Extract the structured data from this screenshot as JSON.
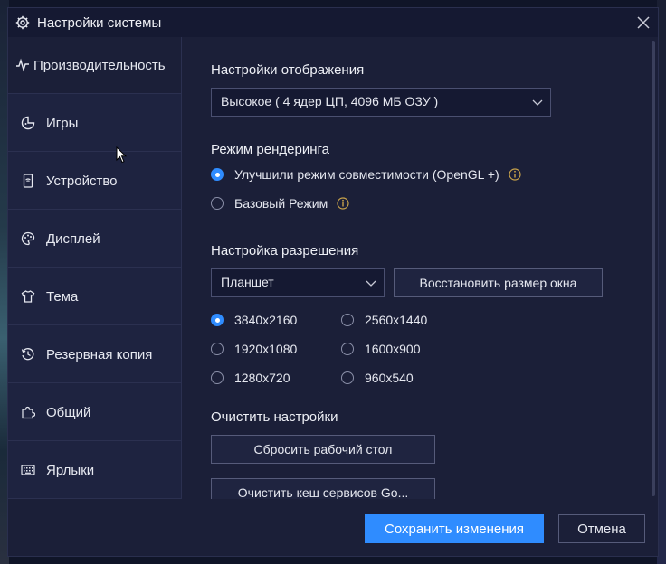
{
  "window": {
    "title": "Настройки системы"
  },
  "sidebar": {
    "items": [
      {
        "label": "Производительность",
        "icon": "pulse-icon",
        "active": true
      },
      {
        "label": "Игры",
        "icon": "gamepad-icon"
      },
      {
        "label": "Устройство",
        "icon": "phone-icon"
      },
      {
        "label": "Дисплей",
        "icon": "palette-icon"
      },
      {
        "label": "Тема",
        "icon": "shirt-icon"
      },
      {
        "label": "Резервная копия",
        "icon": "history-icon"
      },
      {
        "label": "Общий",
        "icon": "puzzle-icon"
      },
      {
        "label": "Ярлыки",
        "icon": "keyboard-icon"
      }
    ]
  },
  "display": {
    "title": "Настройки отображения",
    "selected": "Высокое ( 4 ядер ЦП, 4096 МБ ОЗУ )"
  },
  "render": {
    "title": "Режим рендеринга",
    "options": [
      {
        "label": "Улучшили режим совместимости (OpenGL +)",
        "checked": true
      },
      {
        "label": "Базовый Режим",
        "checked": false
      }
    ]
  },
  "resolution": {
    "title": "Настройка разрешения",
    "device_selected": "Планшет",
    "restore_button": "Восстановить размер окна",
    "options": [
      {
        "label": "3840x2160",
        "checked": true
      },
      {
        "label": "2560x1440",
        "checked": false
      },
      {
        "label": "1920x1080",
        "checked": false
      },
      {
        "label": "1600x900",
        "checked": false
      },
      {
        "label": "1280x720",
        "checked": false
      },
      {
        "label": "960x540",
        "checked": false
      }
    ]
  },
  "clear": {
    "title": "Очистить настройки",
    "reset_desktop": "Сбросить рабочий стол",
    "clear_cache": "Очистить кеш сервисов Go..."
  },
  "footer": {
    "save": "Сохранить изменения",
    "cancel": "Отмена"
  },
  "colors": {
    "accent": "#2f8cff",
    "info": "#c8a24a",
    "background": "#1b1f38",
    "sidebar": "#1e2340"
  }
}
